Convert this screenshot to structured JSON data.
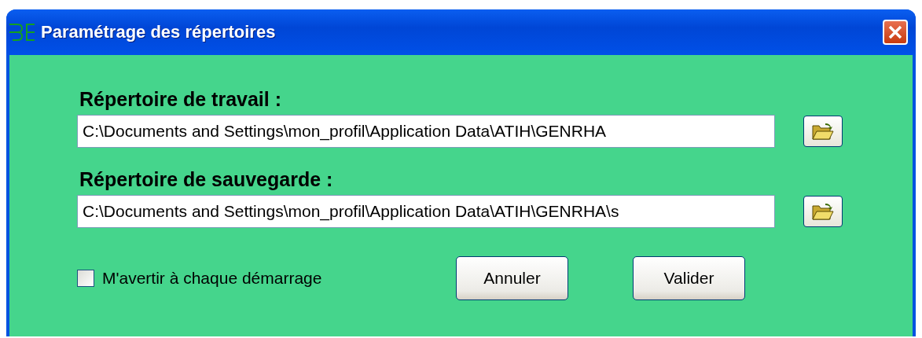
{
  "window": {
    "title": "Paramétrage des répertoires"
  },
  "directories": [
    {
      "label": "Répertoire de travail :",
      "value": "C:\\Documents and Settings\\mon_profil\\Application Data\\ATIH\\GENRHA"
    },
    {
      "label": "Répertoire de sauvegarde :",
      "value": "C:\\Documents and Settings\\mon_profil\\Application Data\\ATIH\\GENRHA\\s"
    }
  ],
  "warn_checkbox": {
    "label": "M'avertir à chaque démarrage",
    "checked": false
  },
  "buttons": [
    "Annuler",
    "Valider"
  ]
}
